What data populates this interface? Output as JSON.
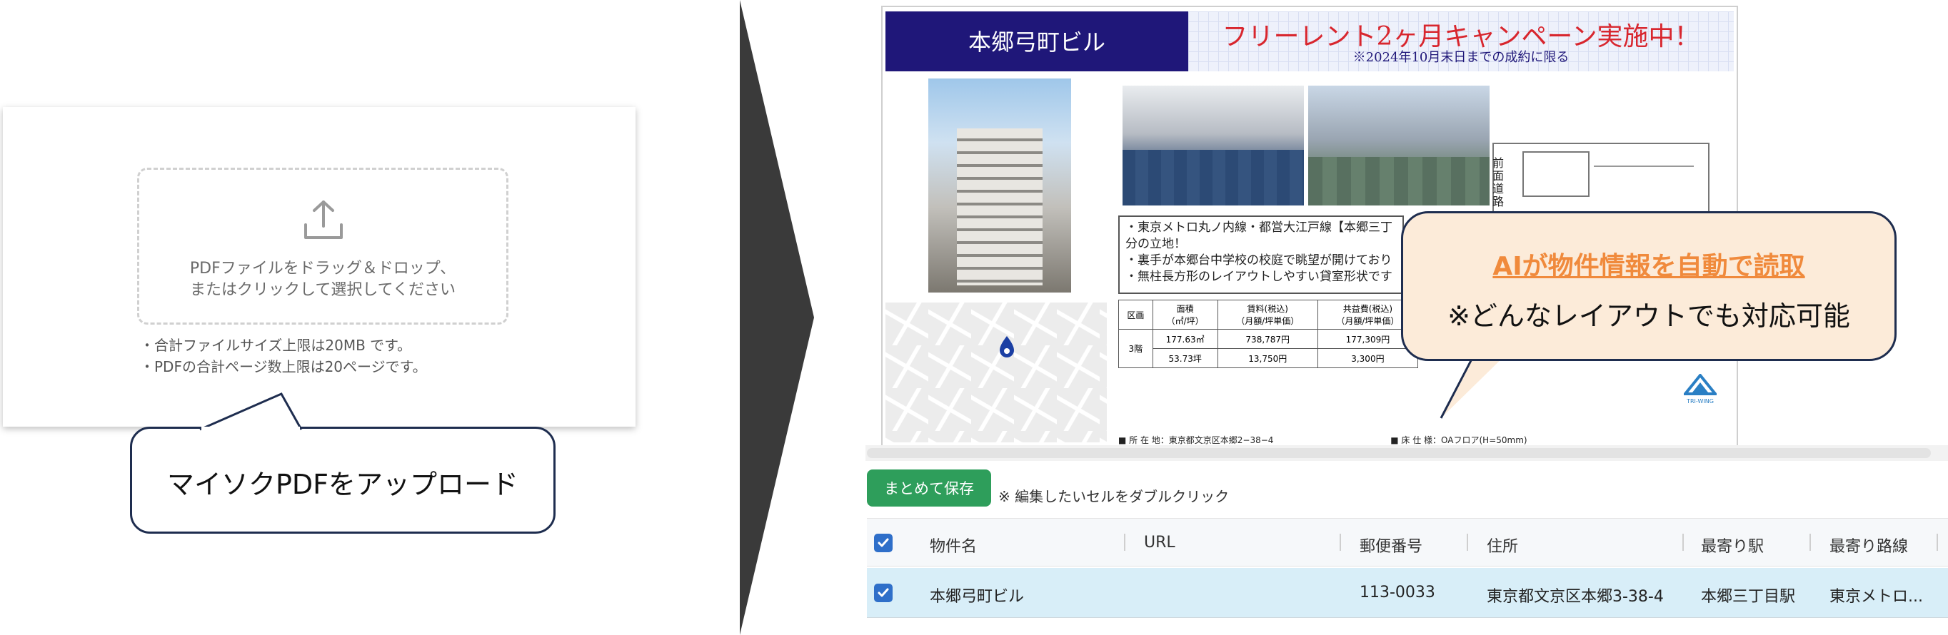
{
  "upload": {
    "dropzone_line1": "PDFファイルをドラッグ＆ドロップ、",
    "dropzone_line2": "またはクリックして選択してください",
    "note1": "・合計ファイルサイズ上限は20MB です。",
    "note2": "・PDFの合計ページ数上限は20ページです。",
    "callout": "マイソクPDFをアップロード"
  },
  "flyer": {
    "title": "本郷弓町ビル",
    "campaign_title": "フリーレント2ヶ月キャンペーン実施中！",
    "campaign_sub": "※2024年10月末日までの成約に限る",
    "bullets": [
      "・東京メトロ丸ノ内線・都営大江戸線【本郷三丁",
      "分の立地！",
      "・裏手が本郷台中学校の校庭で眺望が開けており",
      "・無柱長方形のレイアウトしやすい貸室形状です"
    ],
    "table_header": [
      "区画",
      "面積",
      "賃料(税込)",
      "共益費(税込)"
    ],
    "table_sub": [
      "",
      "（㎡/坪）",
      "（月額/坪単価）",
      "（月額/坪単価）"
    ],
    "table_row1": [
      "3階",
      "177.63㎡",
      "738,787円",
      "177,309円"
    ],
    "table_row2": [
      "",
      "53.73坪",
      "13,750円",
      "3,300円"
    ],
    "footer_address": "■ 所 在 地：東京都文京区本郷2−38−4",
    "footer_floor": "■ 床 仕 様：OAフロア(H=50mm)",
    "road_label": "前面道路",
    "logo_text": "TRI-WING"
  },
  "ai_callout": {
    "title": "AIが物件情報を自動で読取",
    "subtitle": "※どんなレイアウトでも対応可能"
  },
  "toolbar": {
    "save_label": "まとめて保存",
    "hint": "※ 編集したいセルをダブルクリック"
  },
  "grid": {
    "columns": [
      "物件名",
      "URL",
      "郵便番号",
      "住所",
      "最寄り駅",
      "最寄り路線"
    ],
    "row": [
      "本郷弓町ビル",
      "",
      "113-0033",
      "東京都文京区本郷3-38-4",
      "本郷三丁目駅",
      "東京メトロ..."
    ]
  }
}
